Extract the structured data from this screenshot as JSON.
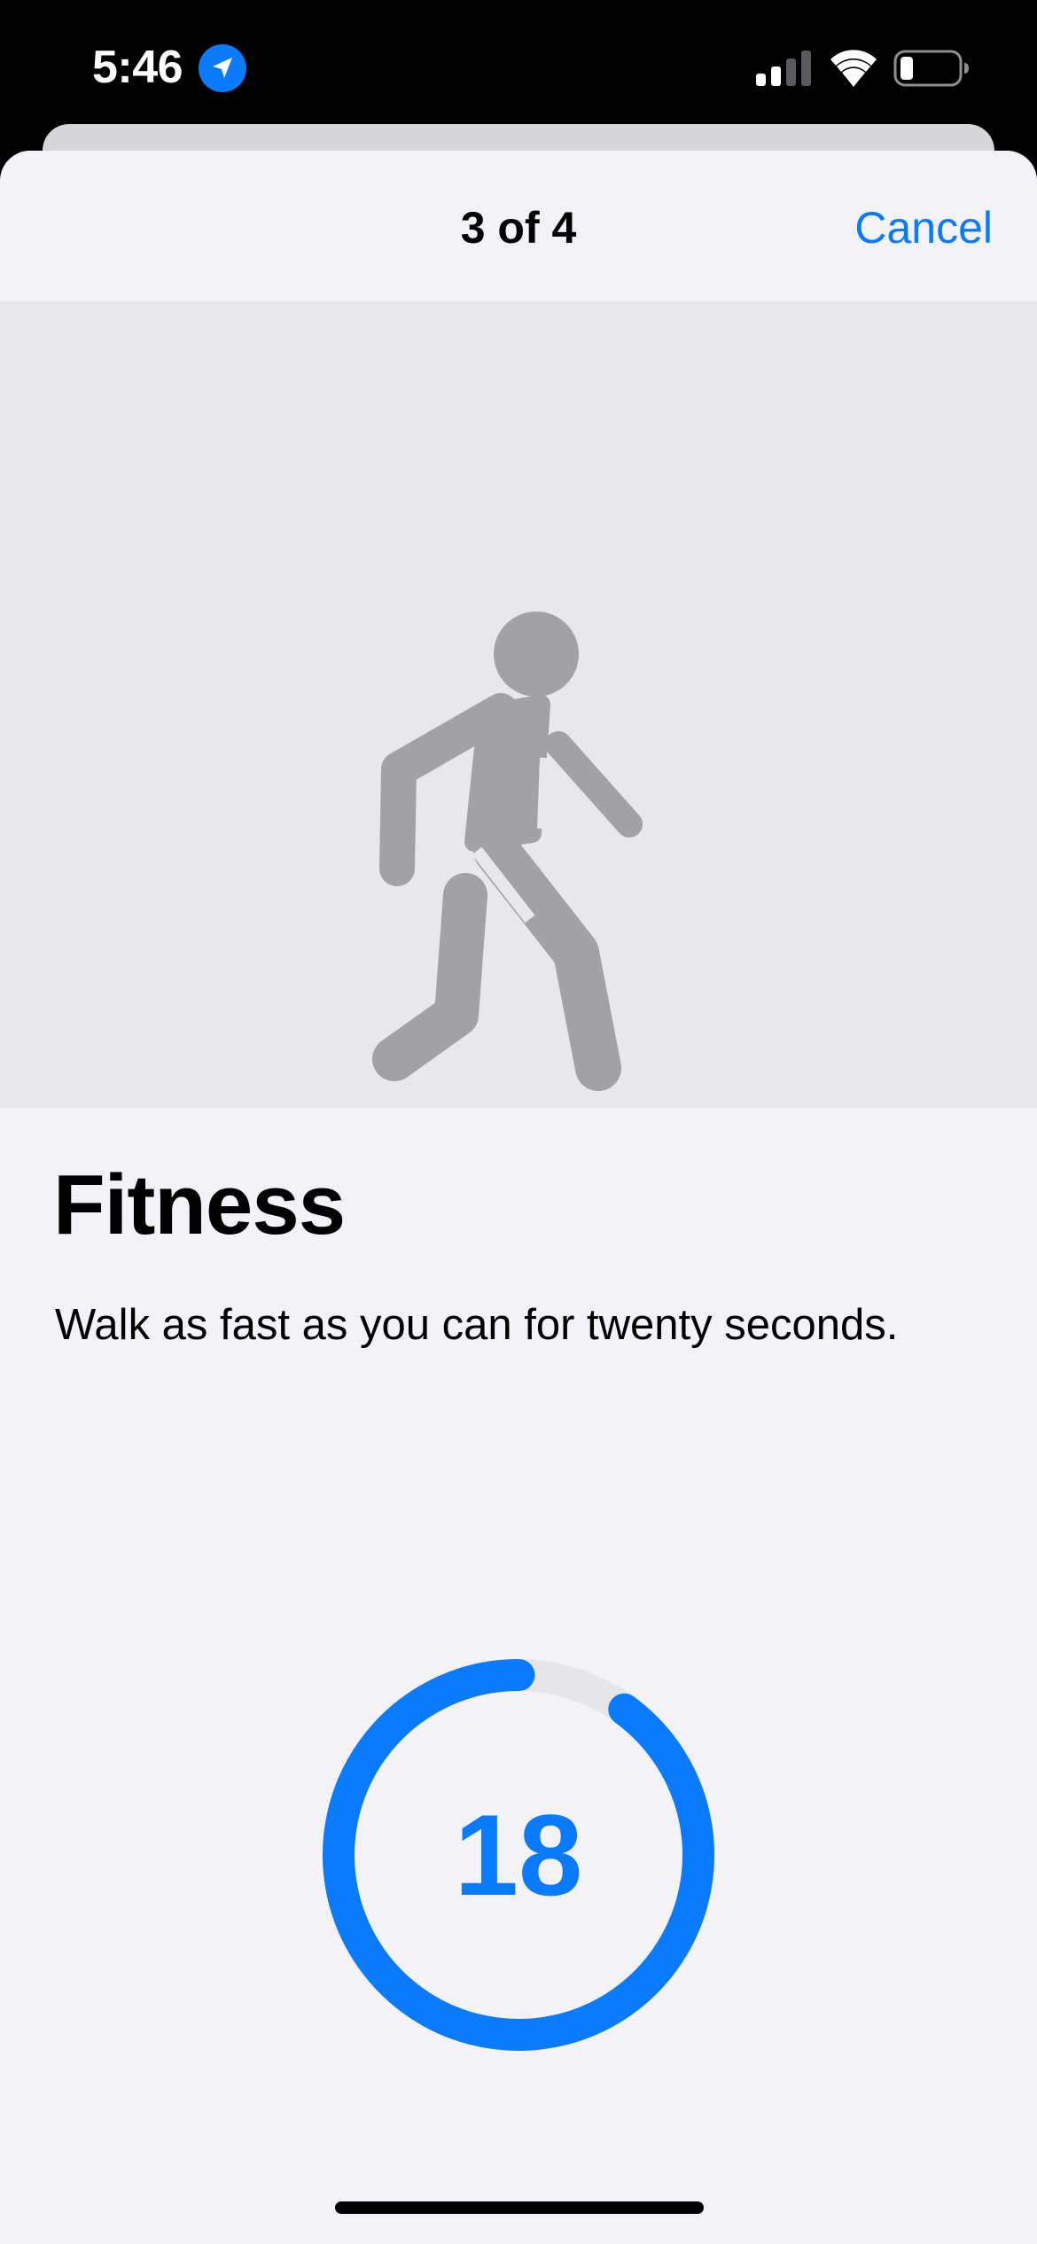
{
  "status_bar": {
    "time": "5:46",
    "icons": [
      "location-arrow-icon",
      "cellular-signal-icon",
      "wifi-icon",
      "battery-icon"
    ]
  },
  "nav": {
    "step": "3 of 4",
    "cancel_label": "Cancel"
  },
  "content": {
    "hero_icon": "figure-walk-icon",
    "title": "Fitness",
    "instruction": "Walk as fast as you can for twenty seconds."
  },
  "timer": {
    "value": "18",
    "total_seconds": 20,
    "progress_fraction": 0.9
  },
  "colors": {
    "accent": "#0a7aff",
    "background": "#f2f2f7",
    "hero_background": "#e7e7ec",
    "icon_gray": "#a1a1a6",
    "ring_track": "#e5e5ea"
  }
}
